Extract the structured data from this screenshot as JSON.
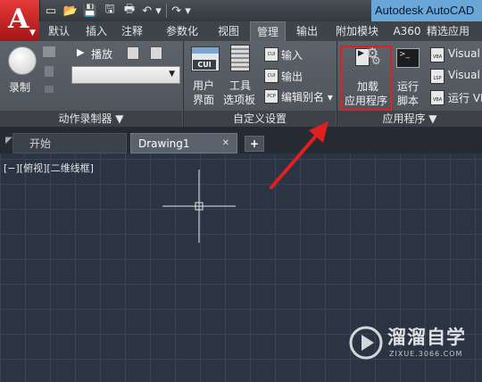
{
  "app_button": {
    "letter": "A",
    "dropdown": "▼"
  },
  "quick_access": {
    "icons": [
      "new-file-icon",
      "open-file-icon",
      "save-icon",
      "save-as-icon",
      "print-icon",
      "undo-icon",
      "redo-icon"
    ],
    "new": "▭",
    "open": "📂",
    "save": "💾",
    "saveas": "🖫",
    "print": "🖶",
    "undo": "↶ ▾",
    "redo": "↷ ▾"
  },
  "title": "Autodesk AutoCAD",
  "ribbon_tabs": [
    "默认",
    "插入",
    "注释",
    "参数化",
    "视图",
    "管理",
    "输出",
    "附加模块",
    "A360",
    "精选应用"
  ],
  "active_tab": "管理",
  "ribbon": {
    "action_recorder": {
      "record_label": "录制",
      "play_label": "播放",
      "panel_title": "动作录制器 ▼"
    },
    "customization": {
      "user_interface": [
        "用户",
        "界面"
      ],
      "tool_palettes": [
        "工具",
        "选项板"
      ],
      "import_label": "输入",
      "export_label": "输出",
      "edit_aliases_label": "编辑别名 ▾",
      "panel_title": "自定义设置"
    },
    "applications": {
      "load_app": [
        "加载",
        "应用程序"
      ],
      "run_script": [
        "运行",
        "脚本"
      ],
      "visual_1": "Visual",
      "visual_2": "Visual",
      "run_vba": "运行 VI",
      "panel_title": "应用程序 ▼"
    },
    "icon_texts": {
      "cui": "CUI",
      "vba": "VBA",
      "pcp": "PCP",
      "lsp": "LSP"
    }
  },
  "document_tabs": [
    {
      "label": "开始",
      "active": false
    },
    {
      "label": "Drawing1",
      "active": true,
      "close": "✕"
    }
  ],
  "add_tab": "+",
  "viewport_label": "[−][俯视][二维线框]",
  "watermark": {
    "text": "溜溜自学",
    "url": "ZIXUE.3066.COM"
  },
  "colors": {
    "highlight": "#e02020",
    "arrow": "#e02020",
    "canvas": "#2b3443"
  }
}
